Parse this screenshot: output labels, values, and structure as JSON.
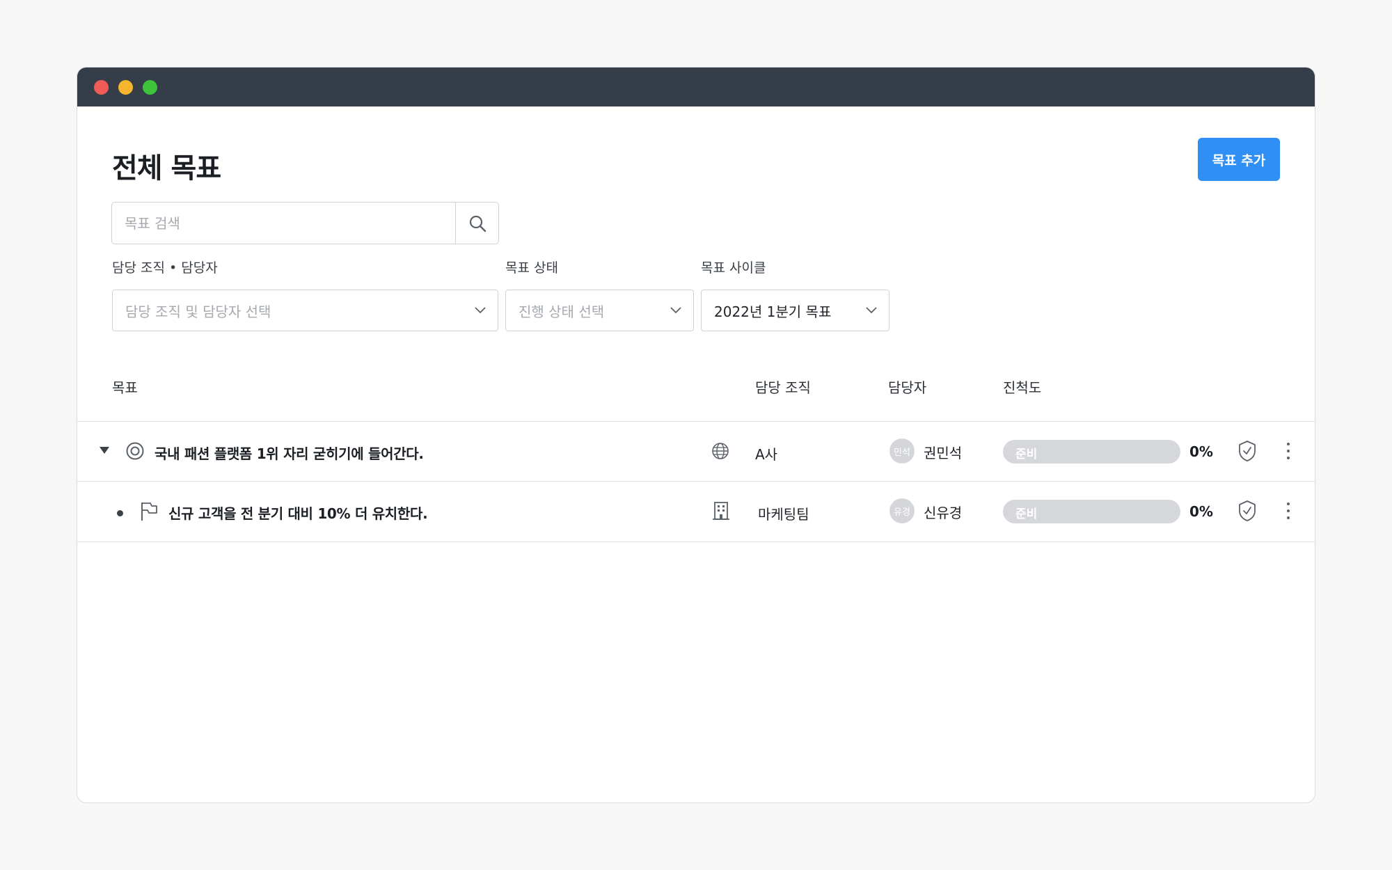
{
  "window": {
    "controls": [
      "close",
      "minimize",
      "maximize"
    ]
  },
  "header": {
    "title": "전체 목표",
    "add_button_label": "목표 추가"
  },
  "search": {
    "placeholder": "목표 검색",
    "value": "",
    "icon": "search-icon"
  },
  "filters": [
    {
      "label": "담당 조직 • 담당자",
      "placeholder": "담당 조직 및 담당자 선택",
      "value": ""
    },
    {
      "label": "목표 상태",
      "placeholder": "진행 상태 선택",
      "value": ""
    },
    {
      "label": "목표 사이클",
      "placeholder": "",
      "value": "2022년 1분기 목표"
    }
  ],
  "table": {
    "columns": [
      "목표",
      "담당 조직",
      "담당자",
      "진척도"
    ],
    "rows": [
      {
        "expand_icon": "caret-down-icon",
        "type_icon": "target-icon",
        "title": "국내 패션 플랫폼 1위 자리 굳히기에 들어간다.",
        "org_icon": "globe-icon",
        "org": "A사",
        "avatar_text": "민석",
        "assignee": "권민석",
        "status": "준비",
        "progress": 0,
        "percent_text": "0%"
      },
      {
        "expand_icon": "bullet-icon",
        "type_icon": "flag-icon",
        "title": "신규 고객을 전 분기 대비 10% 더 유치한다.",
        "org_icon": "building-icon",
        "org": "마케팅팀",
        "avatar_text": "유경",
        "assignee": "신유경",
        "status": "준비",
        "progress": 0,
        "percent_text": "0%"
      }
    ]
  },
  "colors": {
    "accent": "#2f8ff5",
    "titlebar": "#343d48",
    "progress_track": "#d5d7db"
  }
}
